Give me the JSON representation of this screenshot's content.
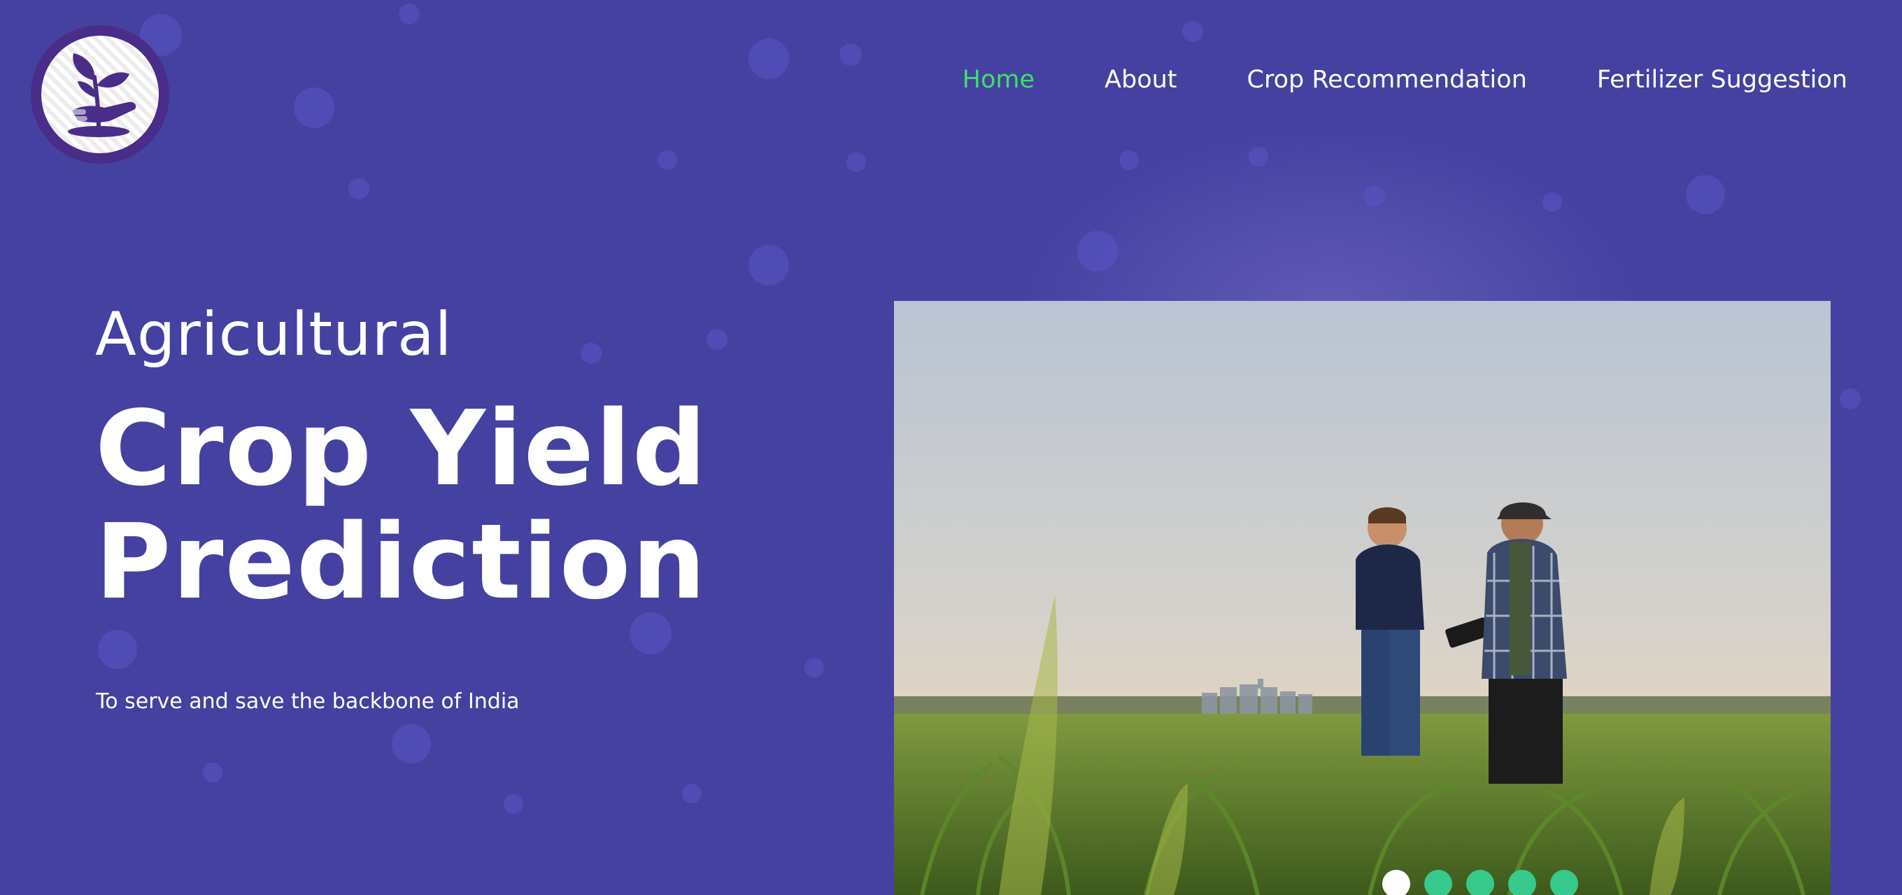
{
  "brand": {
    "logo_icon": "plant-in-hand-icon"
  },
  "nav": {
    "items": [
      {
        "label": "Home",
        "active": true
      },
      {
        "label": "About",
        "active": false
      },
      {
        "label": "Crop Recommendation",
        "active": false
      },
      {
        "label": "Fertilizer Suggestion",
        "active": false
      }
    ],
    "active_color": "#3ee06a"
  },
  "hero": {
    "eyebrow": "Agricultural",
    "headline_line1": "Crop Yield",
    "headline_line2": "Prediction",
    "tagline": "To serve and save the backbone of India",
    "image_description_icon": "farmers-in-cornfield-photo"
  },
  "carousel": {
    "slide_count": 5,
    "active_index": 0,
    "dot_color": "#38c98c",
    "active_dot_color": "#ffffff"
  },
  "colors": {
    "background": "#4541a1",
    "text": "#ffffff"
  }
}
